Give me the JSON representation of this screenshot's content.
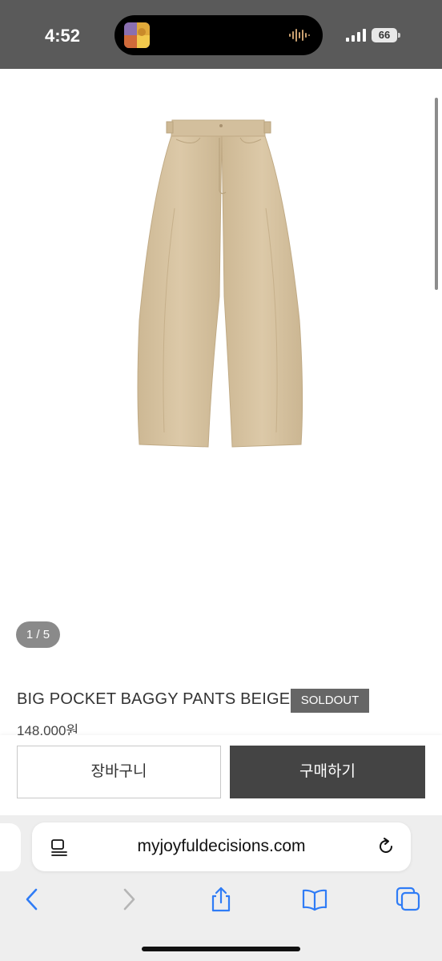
{
  "status_bar": {
    "time": "4:52",
    "battery": "66"
  },
  "gallery": {
    "counter": "1 / 5",
    "product_color": "#d8c4a4"
  },
  "product": {
    "title": "BIG POCKET BAGGY PANTS BEIGE",
    "badge": "SOLDOUT",
    "price": "148,000원"
  },
  "actions": {
    "cart_label": "장바구니",
    "buy_label": "구매하기"
  },
  "browser": {
    "url": "myjoyfuldecisions.com",
    "accent": "#2f7cf6"
  }
}
